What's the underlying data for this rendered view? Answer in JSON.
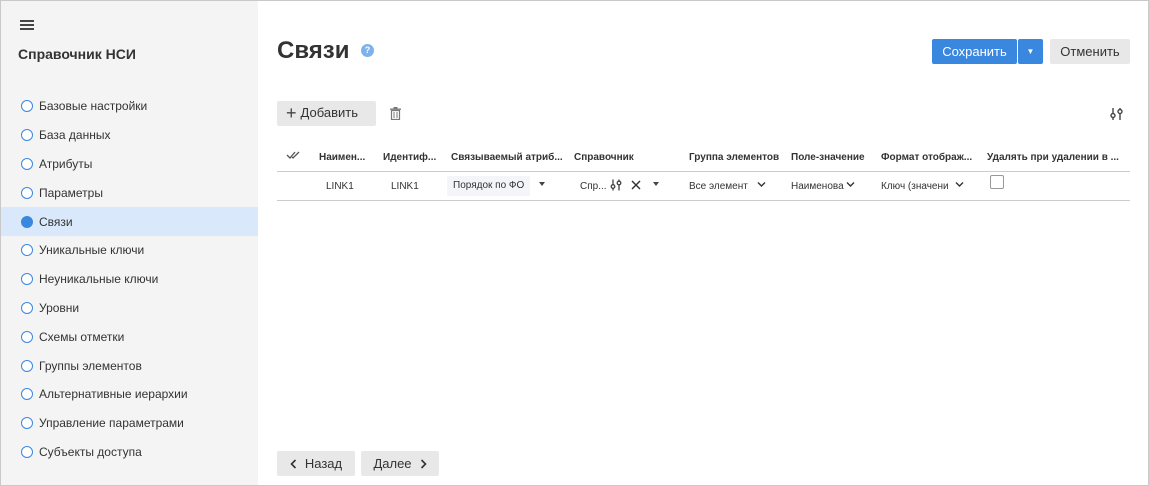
{
  "sidebar": {
    "title": "Справочник НСИ",
    "items": [
      {
        "label": "Базовые настройки",
        "active": false
      },
      {
        "label": "База данных",
        "active": false
      },
      {
        "label": "Атрибуты",
        "active": false
      },
      {
        "label": "Параметры",
        "active": false
      },
      {
        "label": "Связи",
        "active": true
      },
      {
        "label": "Уникальные ключи",
        "active": false
      },
      {
        "label": "Неуникальные ключи",
        "active": false
      },
      {
        "label": "Уровни",
        "active": false
      },
      {
        "label": "Схемы отметки",
        "active": false
      },
      {
        "label": "Группы элементов",
        "active": false
      },
      {
        "label": "Альтернативные иерархии",
        "active": false
      },
      {
        "label": "Управление параметрами",
        "active": false
      },
      {
        "label": "Субъекты доступа",
        "active": false
      }
    ]
  },
  "header": {
    "title": "Связи",
    "help": "?",
    "save_label": "Сохранить",
    "cancel_label": "Отменить"
  },
  "toolbar": {
    "add_label": "Добавить"
  },
  "table": {
    "columns": [
      "Наимен...",
      "Идентиф...",
      "Связываемый атриб...",
      "Справочник",
      "Группа элементов",
      "Поле-значение",
      "Формат отображ...",
      "Удалять при удалении в ..."
    ],
    "rows": [
      {
        "name": "LINK1",
        "id": "LINK1",
        "attribute": "Порядок по ФО",
        "dictionary": "Спр...",
        "group": "Все элемент",
        "value_field": "Наименова",
        "format": "Ключ (значени",
        "delete_checked": false
      }
    ]
  },
  "footer": {
    "back_label": "Назад",
    "next_label": "Далее"
  },
  "colors": {
    "accent": "#3a87e0",
    "sidebar_bg": "#f4f4f4",
    "active_bg": "#d9e9fb",
    "button_gray": "#e8e8e8"
  }
}
